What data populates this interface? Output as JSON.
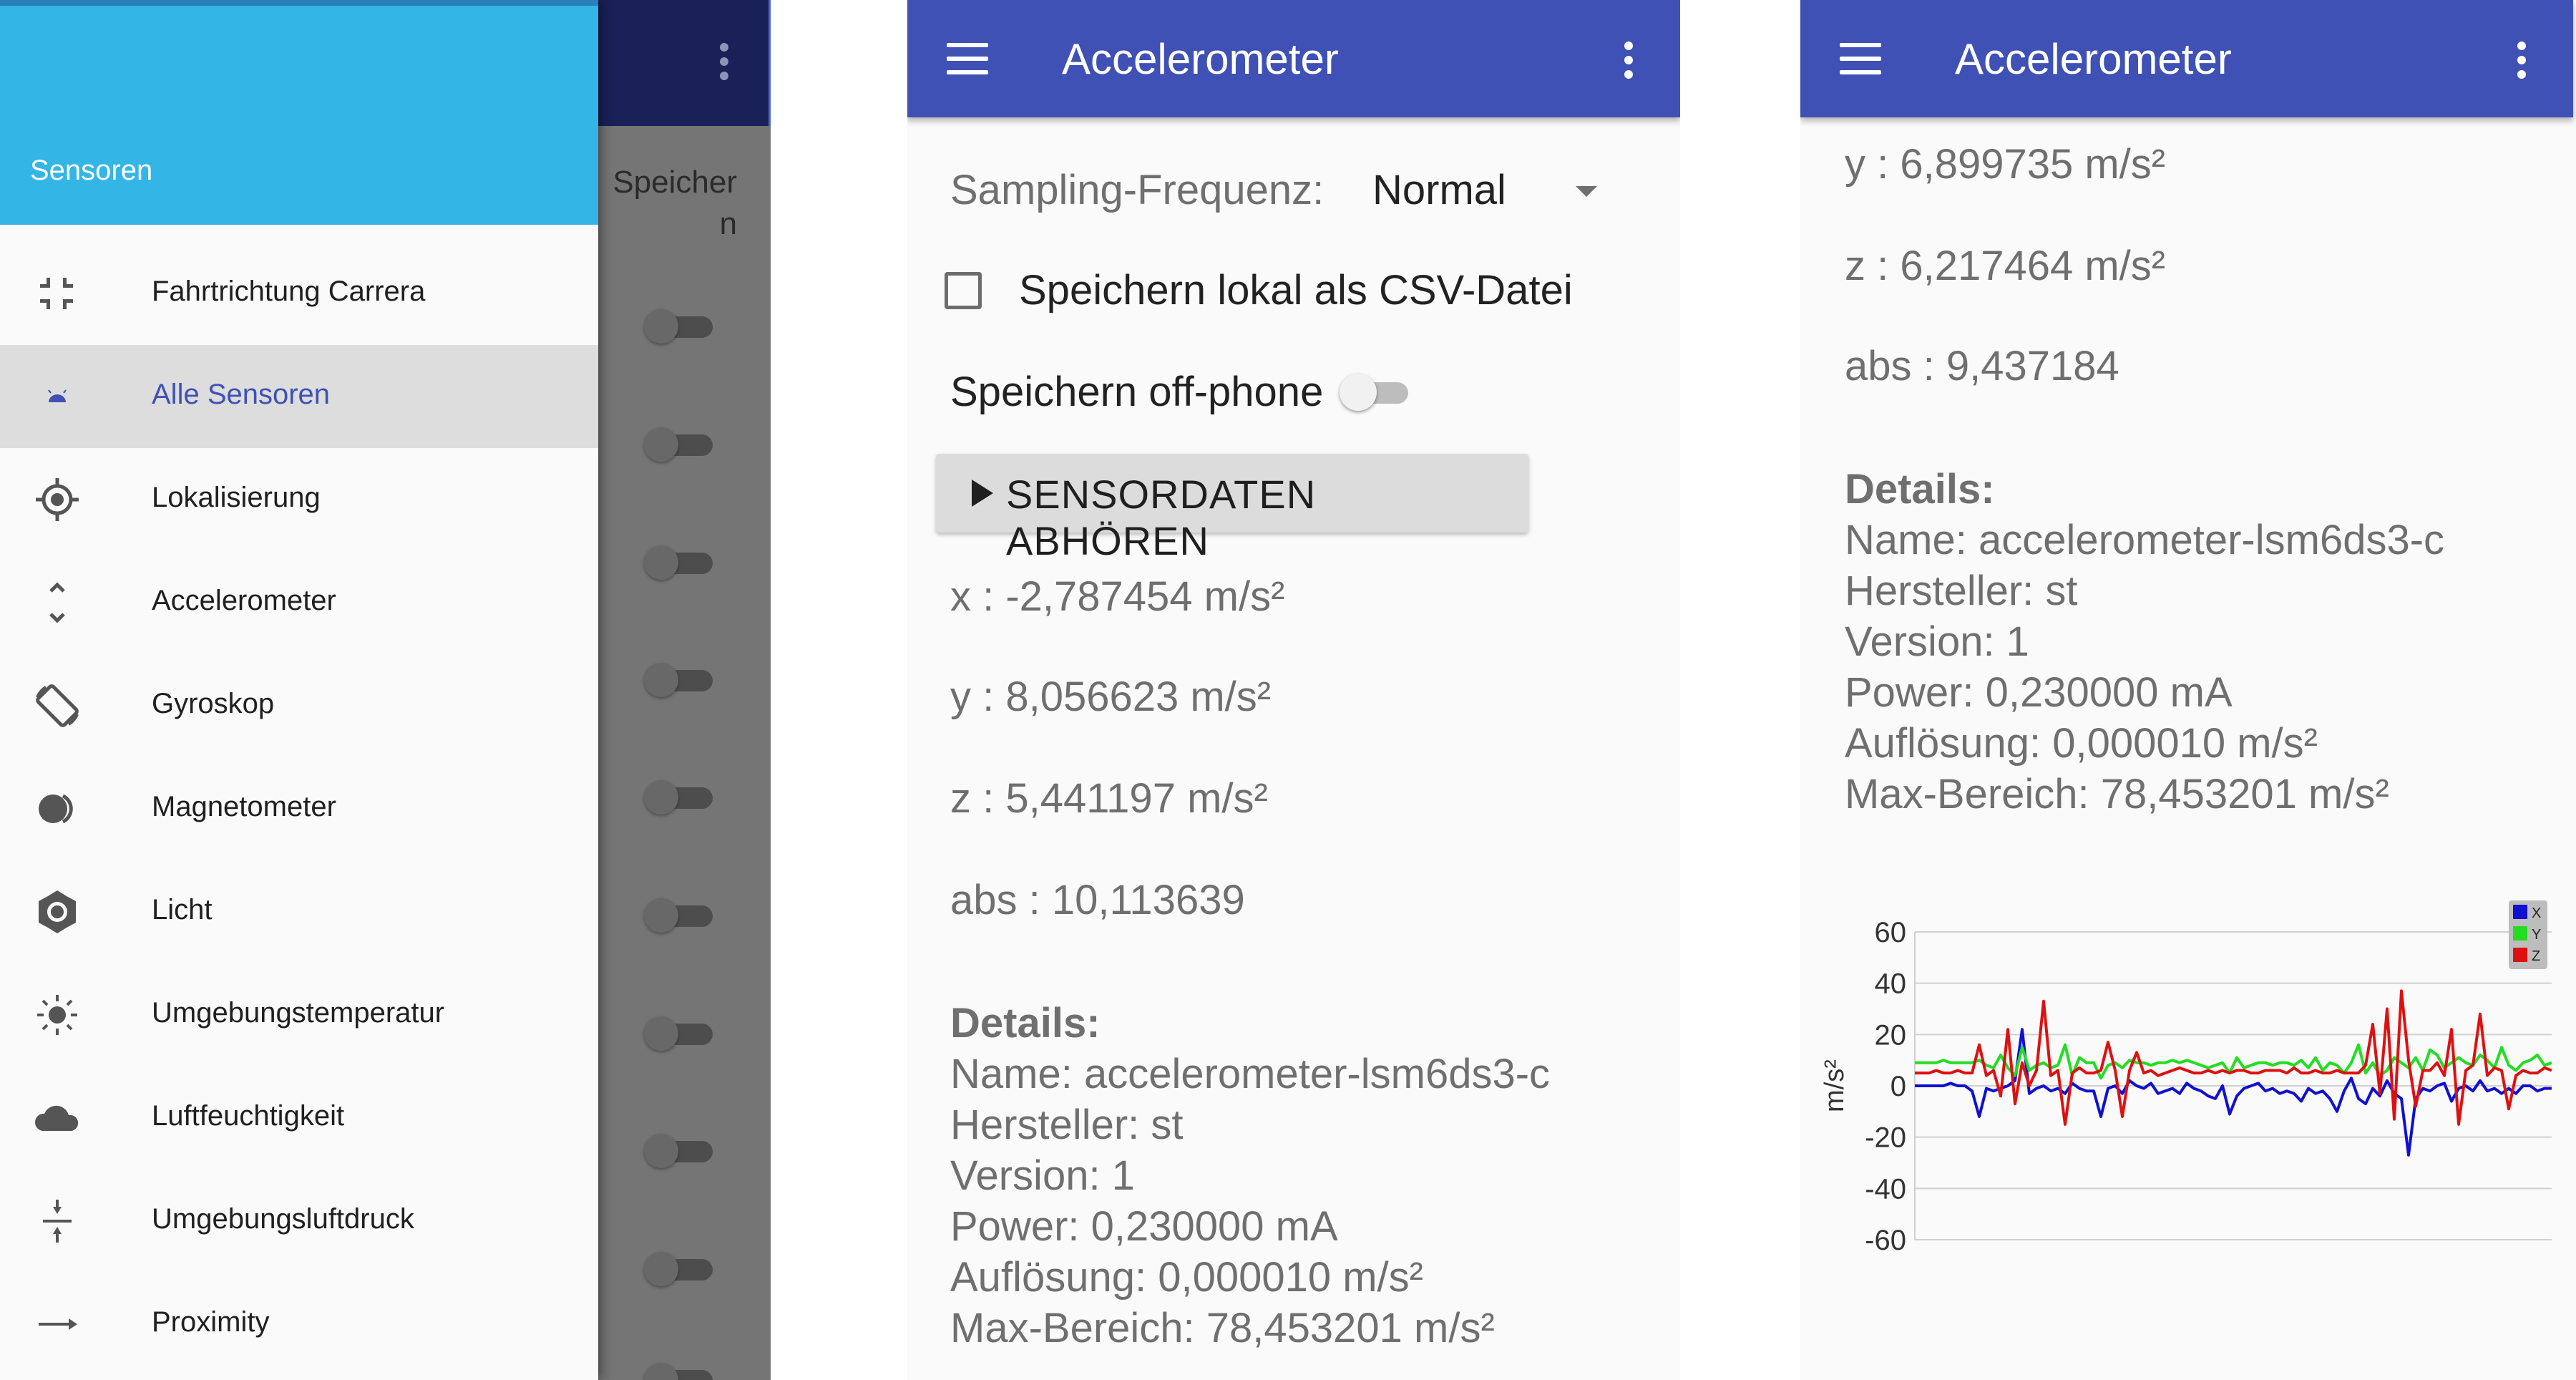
{
  "drawer": {
    "header_title": "Sensoren",
    "underlay_text": "Speicher n",
    "items": [
      {
        "label": "Fahrtrichtung Carrera",
        "icon": "compress-arrows-icon",
        "active": false
      },
      {
        "label": "Alle Sensoren",
        "icon": "android-icon",
        "active": true
      },
      {
        "label": "Lokalisierung",
        "icon": "gps-location-icon",
        "active": false
      },
      {
        "label": "Accelerometer",
        "icon": "unfold-arrows-icon",
        "active": false
      },
      {
        "label": "Gyroskop",
        "icon": "screen-rotation-icon",
        "active": false
      },
      {
        "label": "Magnetometer",
        "icon": "toggle-circle-icon",
        "active": false
      },
      {
        "label": "Licht",
        "icon": "brightness-gear-icon",
        "active": false
      },
      {
        "label": "Umgebungstemperatur",
        "icon": "sun-icon",
        "active": false
      },
      {
        "label": "Luftfeuchtigkeit",
        "icon": "cloud-icon",
        "active": false
      },
      {
        "label": "Umgebungsluftdruck",
        "icon": "vertical-align-center-icon",
        "active": false
      },
      {
        "label": "Proximity",
        "icon": "arrow-right-icon",
        "active": false
      }
    ]
  },
  "panel2": {
    "title": "Accelerometer",
    "sampling_label": "Sampling-Frequenz:",
    "sampling_value": "Normal",
    "csv_label": "Speichern lokal als CSV-Datei",
    "csv_checked": false,
    "offphone_label": "Speichern off-phone",
    "offphone_on": false,
    "button_label": "SENSORDATEN ABHÖREN",
    "x": "x : -2,787454 m/s²",
    "y": "y : 8,056623 m/s²",
    "z": "z : 5,441197 m/s²",
    "abs": "abs : 10,113639",
    "details_heading": "Details:",
    "name": "Name: accelerometer-lsm6ds3-c",
    "vendor": "Hersteller: st",
    "version": "Version: 1",
    "power": "Power: 0,230000 mA",
    "resolution": "Auflösung: 0,000010 m/s²",
    "max_range": "Max-Bereich: 78,453201 m/s²"
  },
  "panel3": {
    "title": "Accelerometer",
    "y": "y : 6,899735 m/s²",
    "z": "z : 6,217464 m/s²",
    "abs": "abs : 9,437184",
    "details_heading": "Details:",
    "name": "Name: accelerometer-lsm6ds3-c",
    "vendor": "Hersteller: st",
    "version": "Version: 1",
    "power": "Power: 0,230000 mA",
    "resolution": "Auflösung: 0,000010 m/s²",
    "max_range": "Max-Bereich: 78,453201 m/s²"
  },
  "colors": {
    "appbar": "#3f51b5",
    "drawer_header": "#33b5e5",
    "active_item_text": "#3f51b5",
    "series_x": "#1010d0",
    "series_y": "#22dd22",
    "series_z": "#dd1111"
  },
  "chart_data": {
    "type": "line",
    "ylabel": "m/s²",
    "ylim": [
      -60,
      60
    ],
    "yticks": [
      60,
      40,
      20,
      0,
      -20,
      -40,
      -60
    ],
    "x": [
      0,
      1,
      2,
      3,
      4,
      5,
      6,
      7,
      8,
      9,
      10,
      11,
      12,
      13,
      14,
      15,
      16,
      17,
      18,
      19,
      20,
      21,
      22,
      23,
      24,
      25,
      26,
      27,
      28,
      29,
      30,
      31,
      32,
      33,
      34,
      35,
      36,
      37,
      38,
      39,
      40,
      41,
      42,
      43,
      44,
      45,
      46,
      47,
      48,
      49,
      50,
      51,
      52,
      53,
      54,
      55,
      56,
      57,
      58,
      59,
      60,
      61,
      62,
      63,
      64,
      65,
      66,
      67,
      68,
      69,
      70,
      71,
      72,
      73,
      74,
      75,
      76,
      77,
      78,
      79,
      80,
      81,
      82,
      83,
      84,
      85,
      86,
      87,
      88,
      89
    ],
    "series": [
      {
        "name": "X",
        "values": [
          0,
          0,
          0,
          0,
          0,
          1,
          0,
          0,
          -2,
          -12,
          -1,
          -2,
          -1,
          0,
          2,
          22,
          -3,
          -1,
          0,
          -2,
          -1,
          -3,
          1,
          -1,
          -2,
          -2,
          -12,
          -1,
          0,
          -3,
          2,
          0,
          -1,
          1,
          -3,
          -2,
          -1,
          -3,
          1,
          -1,
          -2,
          -4,
          -5,
          0,
          -11,
          -4,
          -1,
          0,
          1,
          -2,
          -1,
          -3,
          -2,
          -3,
          -6,
          -1,
          -3,
          -2,
          -5,
          -10,
          -2,
          3,
          -5,
          -7,
          -1,
          -4,
          2,
          -3,
          -5,
          -27,
          -5,
          -1,
          -2,
          0,
          1,
          -6,
          -1,
          0,
          -2,
          2,
          -2,
          -1,
          -3,
          -1,
          -3,
          0,
          0,
          -2,
          -1,
          -1
        ]
      },
      {
        "name": "Y",
        "values": [
          9,
          9,
          9,
          9,
          10,
          9,
          9,
          9,
          9,
          10,
          8,
          7,
          12,
          7,
          4,
          15,
          6,
          8,
          9,
          7,
          8,
          16,
          4,
          11,
          9,
          9,
          3,
          8,
          9,
          7,
          10,
          9,
          9,
          8,
          9,
          9,
          10,
          9,
          10,
          9,
          8,
          7,
          8,
          9,
          5,
          11,
          7,
          8,
          9,
          9,
          8,
          9,
          9,
          8,
          10,
          7,
          11,
          6,
          9,
          8,
          5,
          9,
          16,
          5,
          9,
          4,
          6,
          11,
          9,
          7,
          11,
          6,
          14,
          12,
          7,
          9,
          11,
          9,
          8,
          12,
          10,
          7,
          15,
          8,
          6,
          9,
          10,
          12,
          8,
          9
        ]
      },
      {
        "name": "Z",
        "values": [
          5,
          5,
          5,
          6,
          5,
          5,
          6,
          5,
          5,
          16,
          4,
          6,
          -4,
          22,
          -7,
          9,
          0,
          6,
          33,
          4,
          6,
          -15,
          5,
          7,
          5,
          5,
          6,
          17,
          6,
          -12,
          6,
          13,
          5,
          6,
          4,
          5,
          6,
          7,
          6,
          5,
          5,
          6,
          5,
          6,
          5,
          6,
          6,
          5,
          5,
          6,
          6,
          6,
          5,
          7,
          5,
          5,
          6,
          5,
          5,
          6,
          5,
          5,
          5,
          8,
          24,
          -3,
          30,
          -13,
          37,
          10,
          -8,
          6,
          6,
          9,
          4,
          22,
          -15,
          6,
          8,
          28,
          4,
          7,
          6,
          -9,
          4,
          6,
          5,
          5,
          7,
          6
        ]
      }
    ]
  }
}
